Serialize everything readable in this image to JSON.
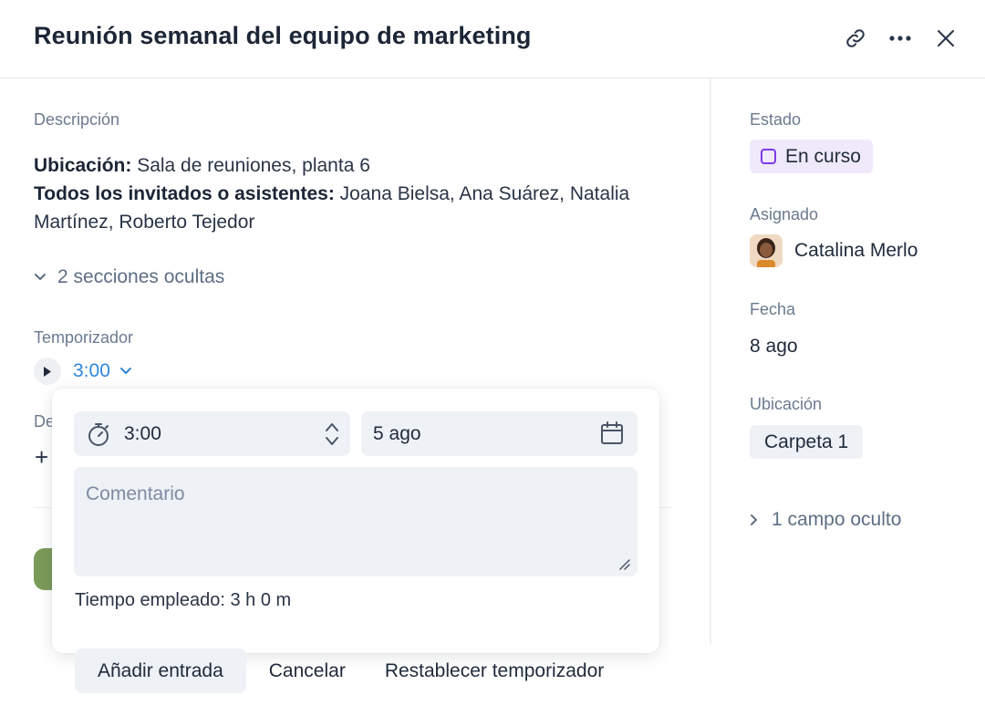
{
  "header": {
    "title": "Reunión semanal del equipo de marketing",
    "icons": [
      "link-icon",
      "more-icon",
      "close-icon"
    ]
  },
  "main": {
    "description_label": "Descripción",
    "location_label": "Ubicación:",
    "location_value": " Sala de reuniones, planta 6",
    "guests_label": "Todos los invitados o asistentes:",
    "guests_value_line1": " Joana Bielsa, Ana Suárez, Natalia",
    "guests_value_line2": "Martínez, Roberto Tejedor",
    "hidden_sections": "2 secciones ocultas",
    "timer_label": "Temporizador",
    "timer_value": "3:00",
    "obscured_label": "De",
    "obscured_plus": "+"
  },
  "popup": {
    "duration_value": "3:00",
    "date_value": "5 ago",
    "comment_placeholder": "Comentario",
    "time_spent": "Tiempo empleado: 3 h 0 m"
  },
  "actions": {
    "add_entry": "Añadir entrada",
    "cancel": "Cancelar",
    "reset_timer": "Restablecer temporizador"
  },
  "sidebar": {
    "status_label": "Estado",
    "status_value": "En curso",
    "assignee_label": "Asignado",
    "assignee_name": "Catalina Merlo",
    "date_label": "Fecha",
    "date_value": "8 ago",
    "location_label": "Ubicación",
    "location_value": "Carpeta 1",
    "hidden_field": "1 campo oculto"
  },
  "colors": {
    "accent_blue": "#2e86de",
    "status_purple": "#7c3aed",
    "status_bg": "#efe9fb",
    "field_bg": "#eef1f6"
  }
}
